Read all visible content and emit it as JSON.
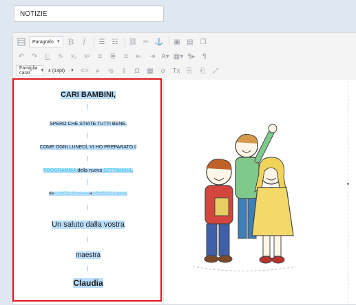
{
  "title_field": {
    "value": "NOTIZIE"
  },
  "toolbar": {
    "row1": {
      "format_select": "Paragrafo",
      "icons": [
        "grid-icon",
        "bold-icon",
        "italic-icon",
        "bullet-list-icon",
        "numbered-list-icon",
        "link-icon",
        "unlink-icon",
        "anchor-icon",
        "image-icon",
        "media-icon",
        "copy-icon"
      ]
    },
    "row2": {
      "icons": [
        "undo-icon",
        "redo-icon",
        "underline-icon",
        "strikethrough-icon",
        "subscript-icon",
        "superscript-icon",
        "align-left-icon",
        "align-center-icon",
        "align-right-icon",
        "outdent-icon",
        "indent-icon",
        "text-color-icon",
        "background-color-icon",
        "ltr-icon",
        "paragraph-mark-icon"
      ]
    },
    "row3": {
      "font_family_select": "Famiglia carat",
      "font_size_select": "4 (14pt)",
      "icons": [
        "code-icon",
        "find-icon",
        "replace-icon",
        "upload-icon",
        "omega-icon",
        "table-icon",
        "strike-icon",
        "clear-format-icon",
        "paste-word-icon",
        "paste-text-icon",
        "fullscreen-icon"
      ]
    }
  },
  "content": {
    "greeting": "CARI BAMBINI,",
    "line2": "SPERO CHE STIATE TUTTI BENE.",
    "line3": "COME OGNI LUNEDÌ, VI HO PREPARATO il",
    "line4_a": "PROGRAMMA",
    "line4_b": " della nuova ",
    "line4_c": "SETTIMANA",
    "line4_d": ".",
    "line5_a": "da ",
    "line5_b": "LUNEDÌ 30 marzo",
    "line5_c": " a ",
    "line5_d": "VENERDÌ 3 aprile",
    "line5_e": ".",
    "line6": "Un saluto dalla vostra",
    "line7": "maestra",
    "line8": "Claudia"
  },
  "colors": {
    "highlight": "#b9ddfb",
    "accent_cyan": "#4fd1f0",
    "frame_red": "#e0161c"
  }
}
